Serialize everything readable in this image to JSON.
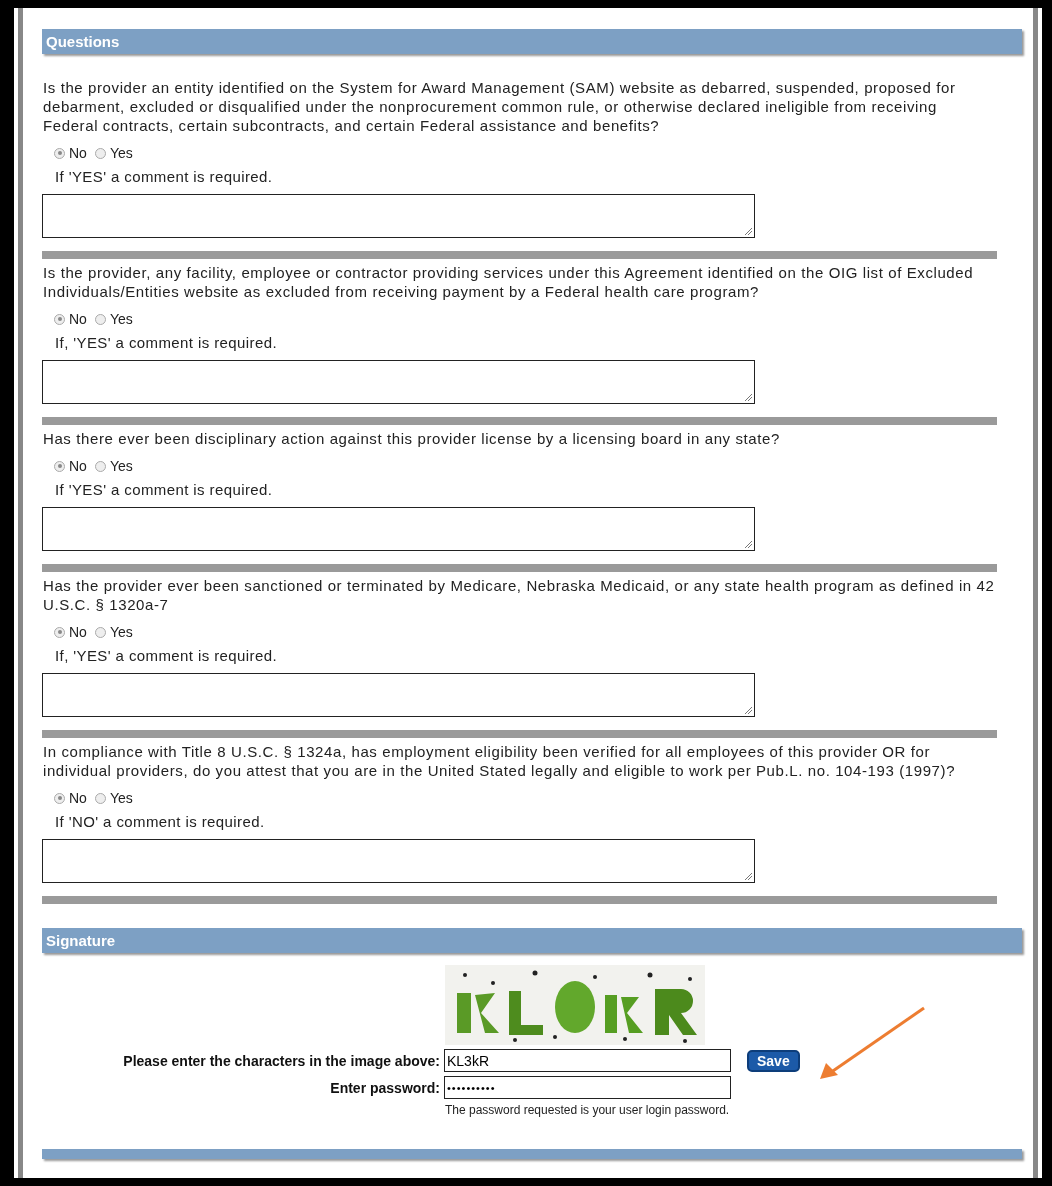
{
  "questions_section": {
    "title": "Questions",
    "questions": [
      {
        "text": "Is the provider an entity identified on the System for Award Management (SAM) website as debarred, suspended, proposed for debarment, excluded or disqualified under the nonprocurement common rule, or otherwise declared ineligible from receiving Federal contracts, certain subcontracts, and certain Federal assistance and benefits?",
        "options": [
          {
            "label": "No",
            "selected": true
          },
          {
            "label": "Yes",
            "selected": false
          }
        ],
        "note": "If 'YES' a comment is required."
      },
      {
        "text": "Is the provider, any facility, employee or contractor providing services under this Agreement identified on the OIG list of Excluded Individuals/Entities website as excluded from receiving payment by a Federal health care program?",
        "options": [
          {
            "label": "No",
            "selected": true
          },
          {
            "label": "Yes",
            "selected": false
          }
        ],
        "note": "If, 'YES' a comment is required."
      },
      {
        "text": "Has there ever been disciplinary action against this provider license by a licensing board in any state?",
        "options": [
          {
            "label": "No",
            "selected": true
          },
          {
            "label": "Yes",
            "selected": false
          }
        ],
        "note": "If 'YES' a comment is required."
      },
      {
        "text": "Has the provider ever been sanctioned or terminated by Medicare, Nebraska Medicaid, or any state health program as defined in 42 U.S.C. § 1320a-7",
        "options": [
          {
            "label": "No",
            "selected": true
          },
          {
            "label": "Yes",
            "selected": false
          }
        ],
        "note": "If, 'YES' a comment is required."
      },
      {
        "text": "In compliance with Title 8 U.S.C. § 1324a, has employment eligibility been verified for all employees of this provider OR for individual providers, do you attest that you are in the United Stated legally and eligible to work per Pub.L. no. 104-193 (1997)?",
        "options": [
          {
            "label": "No",
            "selected": true
          },
          {
            "label": "Yes",
            "selected": false
          }
        ],
        "note": "If 'NO' a comment is required."
      }
    ]
  },
  "signature_section": {
    "title": "Signature",
    "captcha_label": "Please enter the characters in the image above:",
    "captcha_value": "KL3kR",
    "save_button": "Save",
    "password_label": "Enter password:",
    "password_value": "••••••••••",
    "password_hint": "The password requested is your user login password."
  }
}
